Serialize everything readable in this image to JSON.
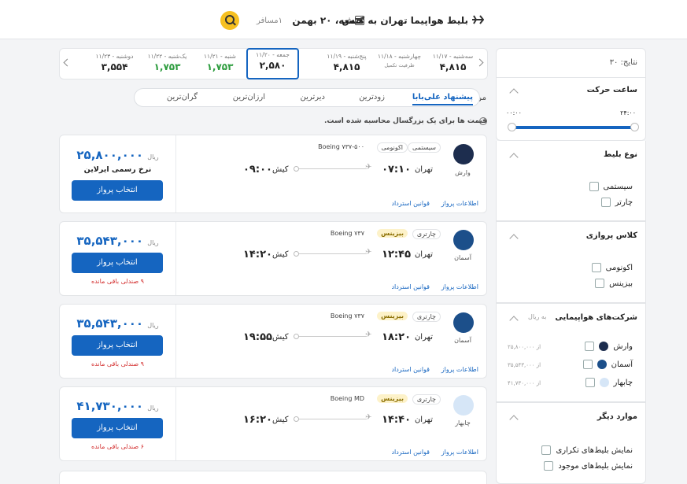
{
  "header": {
    "route": "بلیط هواپیما تهران به کیش",
    "date": "جمعه، ۲۰ بهمن",
    "passengers": "۱مسافر"
  },
  "date_strip": [
    {
      "label": "سه‌شنبه - ۱۱/۱۷",
      "price": "۴,۸۱۵",
      "sub": "",
      "color": "#222"
    },
    {
      "label": "چهارشنبه - ۱۱/۱۸",
      "price": "",
      "sub": "ظرفیت تکمیل",
      "color": "#222"
    },
    {
      "label": "پنج‌شنبه - ۱۱/۱۹",
      "price": "۴,۸۱۵",
      "sub": "",
      "color": "#222"
    },
    {
      "label": "جمعه - ۱۱/۲۰",
      "price": "۲,۵۸۰",
      "sub": "",
      "color": "#222",
      "selected": true
    },
    {
      "label": "شنبه - ۱۱/۲۱",
      "price": "۱,۷۵۳",
      "sub": "",
      "color": "#2e9d3f"
    },
    {
      "label": "یک‌شنبه - ۱۱/۲۲",
      "price": "۱,۷۵۳",
      "sub": "",
      "color": "#2e9d3f"
    },
    {
      "label": "دوشنبه - ۱۱/۲۳",
      "price": "۳,۵۵۴",
      "sub": "",
      "color": "#222"
    }
  ],
  "sort": {
    "label": "مرتب‌سازی:",
    "options": [
      "پیشنهاد علی‌بابا",
      "زودترین",
      "دیرترین",
      "ارزان‌ترین",
      "گران‌ترین"
    ]
  },
  "info_text": "قیمت ها برای یک بزرگسال محاسبه شده است.",
  "flights": [
    {
      "airline": "وارش",
      "tags": [
        "سیستمی",
        "اکونومی",
        "Boeing ۷۳۷-۵۰۰"
      ],
      "dep_city": "تهران",
      "dep_time": "۰۷:۱۰",
      "arr_city": "کیش",
      "arr_time": "۰۹:۰۰",
      "price": "۲۵,۸۰۰,۰۰۰",
      "currency": "ریال",
      "note": "نرخ رسمی ایرلاین",
      "seats": "",
      "logo": "varesh"
    },
    {
      "airline": "آسمان",
      "tags": [
        "چارتری",
        "بیزینس",
        "Boeing ۷۳۷"
      ],
      "dep_city": "تهران",
      "dep_time": "۱۲:۴۵",
      "arr_city": "کیش",
      "arr_time": "۱۴:۲۰",
      "price": "۳۵,۵۴۳,۰۰۰",
      "currency": "ریال",
      "note": "",
      "seats": "۹ صندلی باقی مانده",
      "logo": "aseman"
    },
    {
      "airline": "آسمان",
      "tags": [
        "چارتری",
        "بیزینس",
        "Boeing ۷۳۷"
      ],
      "dep_city": "تهران",
      "dep_time": "۱۸:۲۰",
      "arr_city": "کیش",
      "arr_time": "۱۹:۵۵",
      "price": "۳۵,۵۴۳,۰۰۰",
      "currency": "ریال",
      "note": "",
      "seats": "۹ صندلی باقی مانده",
      "logo": "aseman"
    },
    {
      "airline": "چابهار",
      "tags": [
        "چارتری",
        "بیزینس",
        "Boeing MD"
      ],
      "dep_city": "تهران",
      "dep_time": "۱۴:۴۰",
      "arr_city": "کیش",
      "arr_time": "۱۶:۲۰",
      "price": "۴۱,۷۳۰,۰۰۰",
      "currency": "ریال",
      "note": "",
      "seats": "۶ صندلی باقی مانده",
      "logo": "chabahar"
    }
  ],
  "flight_labels": {
    "select": "انتخاب پرواز",
    "info": "اطلاعات پرواز",
    "refund": "قوانین استرداد"
  },
  "sidebar": {
    "results": "نتایج: ۳۰",
    "time_title": "ساعت حرکت",
    "time_from": "۰۰:۰۰",
    "time_to": "۲۴:۰۰",
    "ticket_type_title": "نوع بلیط",
    "ticket_types": [
      "سیستمی",
      "چارتر"
    ],
    "class_title": "کلاس پروازی",
    "classes": [
      "اکونومی",
      "بیزینس"
    ],
    "airlines_title": "شرکت‌های هواپیمایی",
    "airlines_unit": "به ریال",
    "airlines": [
      {
        "name": "وارش",
        "price": "از ۲۵,۸۰۰,۰۰۰"
      },
      {
        "name": "آسمان",
        "price": "از ۳۵,۵۴۳,۰۰۰"
      },
      {
        "name": "چابهار",
        "price": "از ۴۱,۷۳۰,۰۰۰"
      }
    ],
    "other_title": "موارد دیگر",
    "other": [
      "نمایش بلیط‌های تکراری",
      "نمایش بلیط‌های موجود"
    ]
  },
  "colors": {
    "primary": "#1565c0",
    "accent": "#f6c021",
    "cheap": "#2e9d3f",
    "danger": "#d32f2f"
  }
}
